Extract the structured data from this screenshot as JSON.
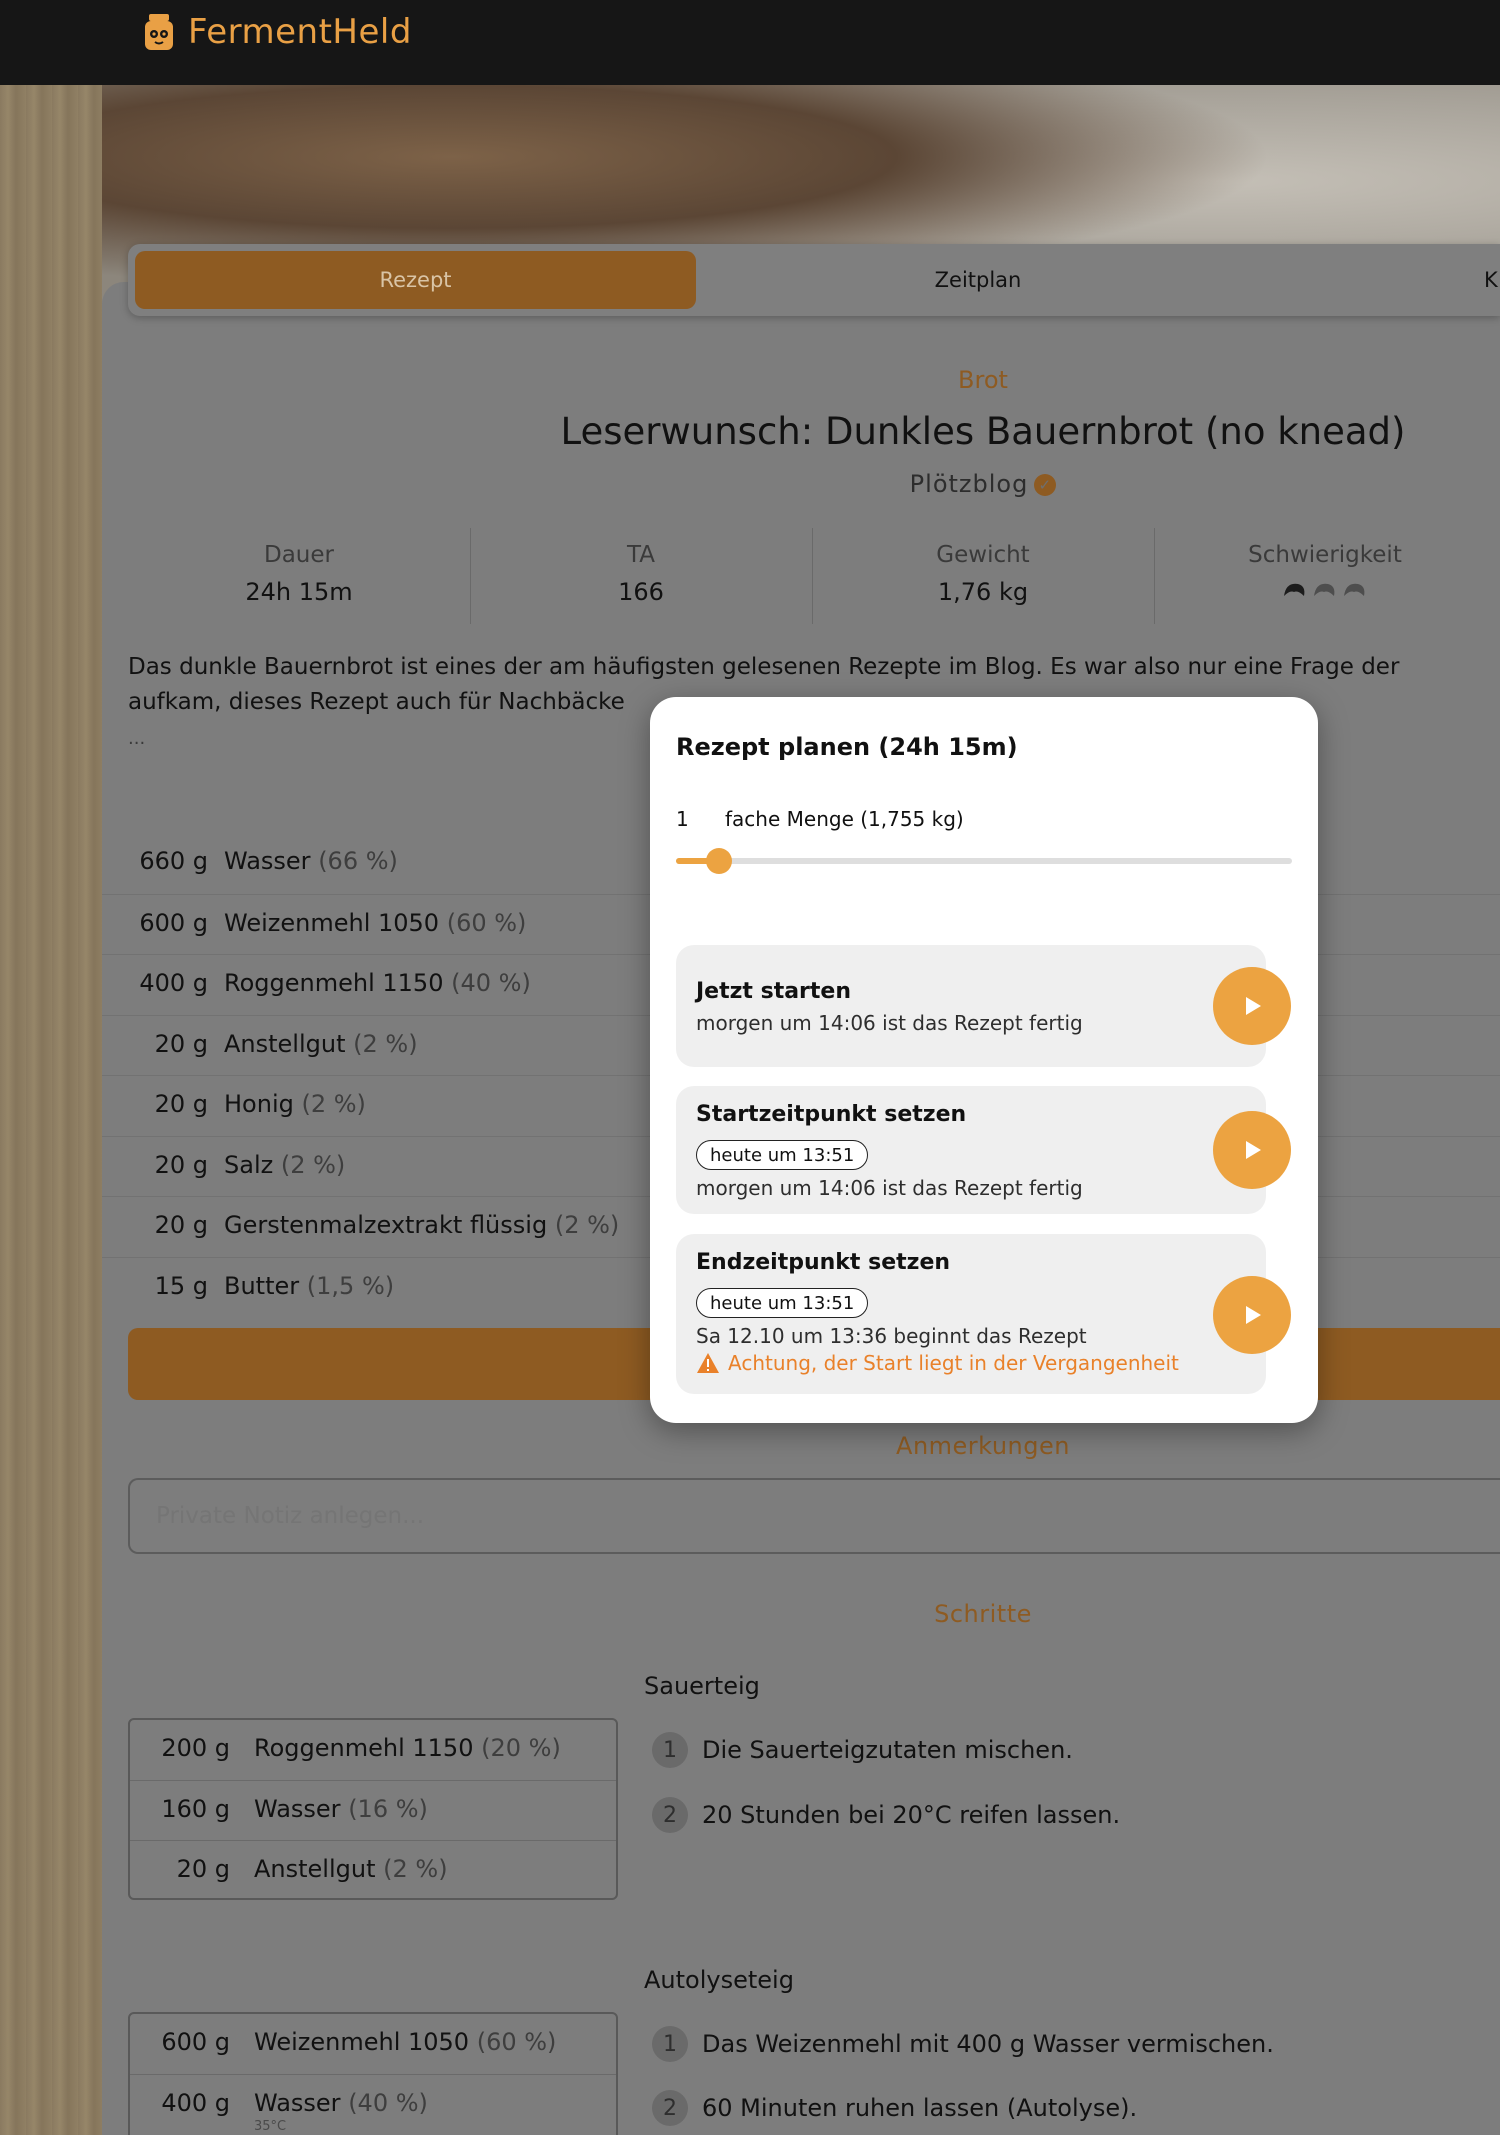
{
  "app": {
    "name": "FermentHeld"
  },
  "tabs": [
    {
      "label": "Rezept"
    },
    {
      "label": "Zeitplan"
    },
    {
      "label": "K"
    }
  ],
  "recipe": {
    "category": "Brot",
    "title": "Leserwunsch: Dunkles Bauernbrot (no knead)",
    "author": "Plötzblog",
    "stats": [
      {
        "label": "Dauer",
        "value": "24h 15m"
      },
      {
        "label": "TA",
        "value": "166"
      },
      {
        "label": "Gewicht",
        "value": "1,76 kg"
      },
      {
        "label": "Schwierigkeit",
        "value": ""
      }
    ],
    "difficulty": {
      "level": 1,
      "max": 3
    },
    "description_line1": "Das dunkle Bauernbrot ist eines der am häufigsten gelesenen Rezepte im Blog. Es war also nur eine Frage der",
    "description_line2": "aufkam, dieses Rezept auch für Nachbäcke",
    "more": "..."
  },
  "ingredients": [
    {
      "qty": "660 g",
      "name": "Wasser",
      "pct": "(66 %)"
    },
    {
      "qty": "600 g",
      "name": "Weizenmehl 1050",
      "pct": "(60 %)"
    },
    {
      "qty": "400 g",
      "name": "Roggenmehl 1150",
      "pct": "(40 %)"
    },
    {
      "qty": "20 g",
      "name": "Anstellgut",
      "pct": "(2 %)"
    },
    {
      "qty": "20 g",
      "name": "Honig",
      "pct": "(2 %)"
    },
    {
      "qty": "20 g",
      "name": "Salz",
      "pct": "(2 %)"
    },
    {
      "qty": "20 g",
      "name": "Gerstenmalzextrakt flüssig",
      "pct": "(2 %)"
    },
    {
      "qty": "15 g",
      "name": "Butter",
      "pct": "(1,5 %)"
    }
  ],
  "notes": {
    "heading": "Anmerkungen",
    "placeholder": "Private Notiz anlegen..."
  },
  "steps": {
    "heading": "Schritte",
    "groups": [
      {
        "title": "Sauerteig",
        "ingredients": [
          {
            "qty": "200 g",
            "name": "Roggenmehl 1150",
            "pct": "(20 %)"
          },
          {
            "qty": "160 g",
            "name": "Wasser",
            "pct": "(16 %)"
          },
          {
            "qty": "20 g",
            "name": "Anstellgut",
            "pct": "(2 %)"
          }
        ],
        "items": [
          {
            "num": "1",
            "text": "Die Sauerteigzutaten mischen."
          },
          {
            "num": "2",
            "text": "20 Stunden bei 20°C reifen lassen."
          }
        ]
      },
      {
        "title": "Autolyseteig",
        "ingredients": [
          {
            "qty": "600 g",
            "name": "Weizenmehl 1050",
            "pct": "(60 %)"
          },
          {
            "qty": "400 g",
            "name": "Wasser",
            "pct": "(40 %)",
            "sub": "35°C"
          }
        ],
        "items": [
          {
            "num": "1",
            "text": "Das Weizenmehl mit 400 g Wasser vermischen."
          },
          {
            "num": "2",
            "text": "60 Minuten ruhen lassen (Autolyse)."
          }
        ]
      }
    ]
  },
  "modal": {
    "title": "Rezept planen (24h 15m)",
    "multiplier": "1",
    "multiplier_label": "fache Menge (1,755 kg)",
    "slider_fraction": 0.07,
    "options": [
      {
        "title": "Jetzt starten",
        "sub": "morgen um 14:06 ist das Rezept fertig"
      },
      {
        "title": "Startzeitpunkt setzen",
        "chip": "heute um 13:51",
        "sub": "morgen um 14:06 ist das Rezept fertig"
      },
      {
        "title": "Endzeitpunkt setzen",
        "chip": "heute um 13:51",
        "sub": "Sa 12.10 um 13:36 beginnt das Rezept",
        "warning": "Achtung, der Start liegt in der Vergangenheit"
      }
    ]
  },
  "colors": {
    "accent": "#eca341",
    "brand": "#8e5b22",
    "warning": "#e9812a"
  }
}
